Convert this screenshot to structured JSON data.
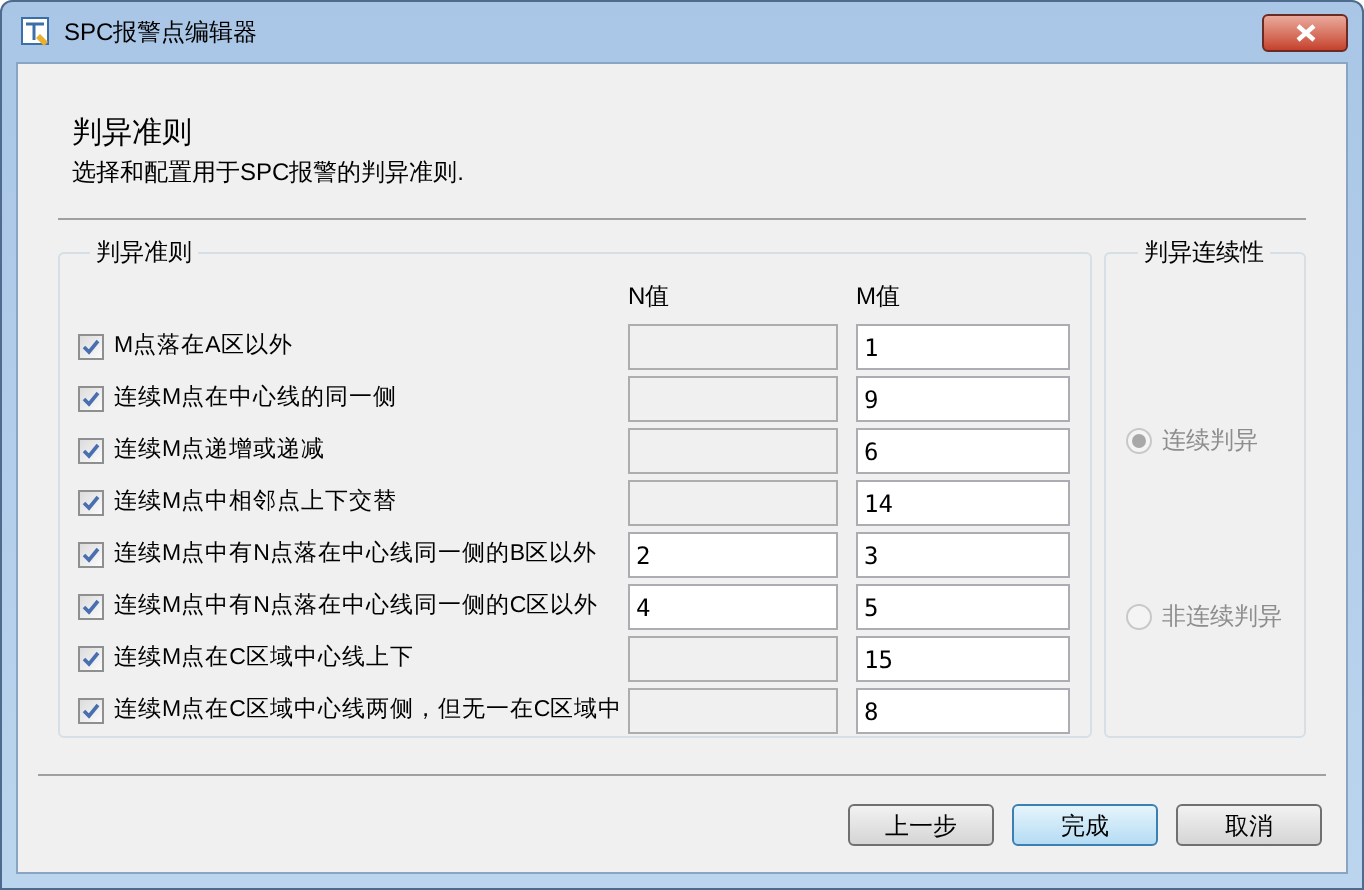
{
  "window": {
    "title": "SPC报警点编辑器"
  },
  "header": {
    "title": "判异准则",
    "description": "选择和配置用于SPC报警的判异准则."
  },
  "rules_group": {
    "title": "判异准则",
    "n_header": "N值",
    "m_header": "M值",
    "rules": [
      {
        "label": "M点落在A区以外",
        "checked": true,
        "n_enabled": false,
        "m_value": "1"
      },
      {
        "label": "连续M点在中心线的同一侧",
        "checked": true,
        "n_enabled": false,
        "m_value": "9"
      },
      {
        "label": "连续M点递增或递减",
        "checked": true,
        "n_enabled": false,
        "m_value": "6"
      },
      {
        "label": "连续M点中相邻点上下交替",
        "checked": true,
        "n_enabled": false,
        "m_value": "14"
      },
      {
        "label": "连续M点中有N点落在中心线同一侧的B区以外",
        "checked": true,
        "n_enabled": true,
        "n_value": "2",
        "m_value": "3"
      },
      {
        "label": "连续M点中有N点落在中心线同一侧的C区以外",
        "checked": true,
        "n_enabled": true,
        "n_value": "4",
        "m_value": "5"
      },
      {
        "label": "连续M点在C区域中心线上下",
        "checked": true,
        "n_enabled": false,
        "m_value": "15"
      },
      {
        "label": "连续M点在C区域中心线两侧，但无一在C区域中",
        "checked": true,
        "n_enabled": false,
        "m_value": "8"
      }
    ]
  },
  "continuity_group": {
    "title": "判异连续性",
    "disabled": true,
    "options": [
      {
        "label": "连续判异",
        "selected": true
      },
      {
        "label": "非连续判异",
        "selected": false
      }
    ]
  },
  "buttons": [
    {
      "label": "上一步",
      "default": false
    },
    {
      "label": "完成",
      "default": true
    },
    {
      "label": "取消",
      "default": false
    }
  ]
}
